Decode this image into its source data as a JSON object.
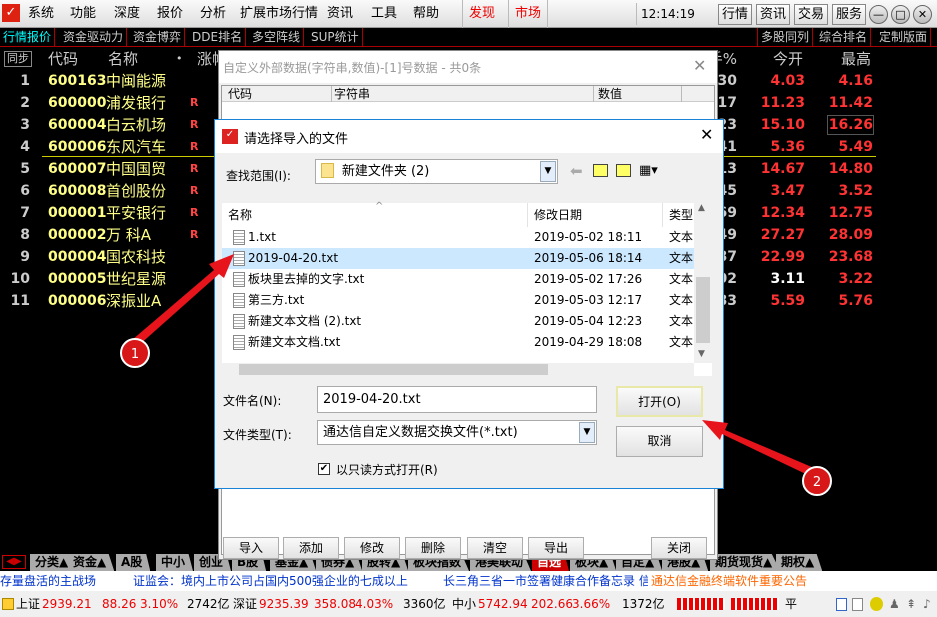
{
  "menubar": {
    "items": [
      "系统",
      "功能",
      "深度",
      "报价",
      "分析",
      "扩展市场行情",
      "资讯",
      "工具",
      "帮助"
    ],
    "red_items": [
      "发现",
      "市场"
    ],
    "clock": "12:14:19 周日",
    "top_buttons": [
      "行情",
      "资讯",
      "交易",
      "服务"
    ]
  },
  "tabbar": {
    "left": [
      "行情报价",
      "资金驱动力",
      "资金博弈",
      "DDE排名",
      "多空阵线",
      "SUP统计"
    ],
    "right": [
      "多股同列",
      "综合排名",
      "定制版面"
    ]
  },
  "table": {
    "sync": "同步",
    "headers": {
      "code": "代码",
      "name": "名称",
      "dot": "•",
      "change": "涨幅",
      "turnover": "换手%",
      "open": "今开",
      "high": "最高"
    },
    "rows": [
      {
        "n": "1",
        "code": "600163",
        "name": "中闽能源",
        "r": "",
        "hs": ".30",
        "open": "4.03",
        "high": "4.16"
      },
      {
        "n": "2",
        "code": "600000",
        "name": "浦发银行",
        "r": "R",
        "hs": ".17",
        "open": "11.23",
        "high": "11.42"
      },
      {
        "n": "3",
        "code": "600004",
        "name": "白云机场",
        "r": "R",
        "hs": "23",
        "open": "15.10",
        "high": "16.26"
      },
      {
        "n": "4",
        "code": "600006",
        "name": "东风汽车",
        "r": "R",
        "hs": "41",
        "open": "5.36",
        "high": "5.49"
      },
      {
        "n": "5",
        "code": "600007",
        "name": "中国国贸",
        "r": "R",
        "hs": "13",
        "open": "14.67",
        "high": "14.80"
      },
      {
        "n": "6",
        "code": "600008",
        "name": "首创股份",
        "r": "R",
        "hs": "45",
        "open": "3.47",
        "high": "3.52"
      },
      {
        "n": "7",
        "code": "000001",
        "name": "平安银行",
        "r": "R",
        "hs": "69",
        "open": "12.34",
        "high": "12.75"
      },
      {
        "n": "8",
        "code": "000002",
        "name": "万 科A",
        "r": "R",
        "hs": "49",
        "open": "27.27",
        "high": "28.09"
      },
      {
        "n": "9",
        "code": "000004",
        "name": "国农科技",
        "r": "",
        "hs": "87",
        "open": "22.99",
        "high": "23.68"
      },
      {
        "n": "10",
        "code": "000005",
        "name": "世纪星源",
        "r": "",
        "hs": "02",
        "open": "3.11",
        "high": "3.22"
      },
      {
        "n": "11",
        "code": "000006",
        "name": "深振业A",
        "r": "",
        "hs": "83",
        "open": "5.59",
        "high": "5.76"
      }
    ]
  },
  "bottom_tabs": [
    "分类▲",
    "资金▲",
    "A股",
    "中小",
    "创业",
    "B股",
    "基金▲",
    "债券▲",
    "股转▲",
    "板块指数",
    "港美联动",
    "自选",
    "板块▲",
    "自定▲",
    "港股▲",
    "期货现货▲",
    "期权▲"
  ],
  "ticker": {
    "items": [
      "存量盘活的主战场",
      "证监会：境内上市公司占国内500强企业的七成以上",
      "长三角三省一市签署健康合作备忘录  信"
    ],
    "notice": "通达信金融终端软件重要公告"
  },
  "status": {
    "sh_label": "上证",
    "sh": "2939.21",
    "sh_chg": "88.26",
    "sh_pct": "3.10%",
    "sh_amt": "2742亿",
    "sz_label": "深证",
    "sz": "9235.39",
    "sz_chg": "358.08",
    "sz_pct": "4.03%",
    "sz_amt": "3360亿",
    "zx_label": "中小",
    "zx": "5742.94",
    "zx_chg": "202.66",
    "zx_pct": "3.66%",
    "zx_amt": "1372亿",
    "flat": "平"
  },
  "custom_dialog": {
    "title": "自定义外部数据(字符串,数值)-[1]号数据 - 共0条",
    "columns": [
      "代码",
      "字符串",
      "数值"
    ],
    "buttons": [
      "导入",
      "添加",
      "修改",
      "删除",
      "清空",
      "导出"
    ],
    "close": "关闭"
  },
  "file_dialog": {
    "title": "请选择导入的文件",
    "lookin_label": "查找范围(I):",
    "lookin_value": "新建文件夹 (2)",
    "columns": [
      "名称",
      "修改日期",
      "类型"
    ],
    "files": [
      {
        "name": "1.txt",
        "date": "2019-05-02 18:11",
        "type": "文本"
      },
      {
        "name": "2019-04-20.txt",
        "date": "2019-05-06 18:14",
        "type": "文本"
      },
      {
        "name": "板块里去掉的文字.txt",
        "date": "2019-05-02 17:26",
        "type": "文本"
      },
      {
        "name": "第三方.txt",
        "date": "2019-05-03 12:17",
        "type": "文本"
      },
      {
        "name": "新建文本文档 (2).txt",
        "date": "2019-05-04 12:23",
        "type": "文本"
      },
      {
        "name": "新建文本文档.txt",
        "date": "2019-04-29 18:08",
        "type": "文本"
      }
    ],
    "filename_label": "文件名(N):",
    "filename_value": "2019-04-20.txt",
    "filetype_label": "文件类型(T):",
    "filetype_value": "通达信自定义数据交换文件(*.txt)",
    "readonly_label": "以只读方式打开(R)",
    "readonly_checked": true,
    "open": "打开(O)",
    "cancel": "取消"
  },
  "annotations": [
    "1",
    "2"
  ],
  "colors": {
    "up": "#ff3333",
    "code": "#ffff88",
    "accent_arrow": "#e8141c",
    "selection": "#cce8ff"
  }
}
